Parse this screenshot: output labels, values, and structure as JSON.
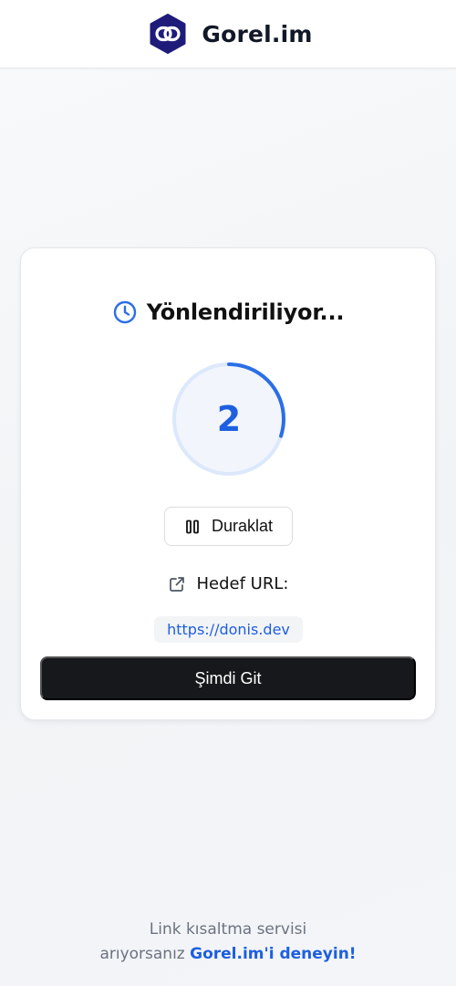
{
  "header": {
    "brand_name": "Gorel.im",
    "logo_icon": "link-chain-hexagon-icon",
    "logo_color": "#1e1b7a"
  },
  "card": {
    "title": "Yönlendiriliyor...",
    "title_icon": "clock-icon",
    "countdown": {
      "value": "2",
      "progress_fraction": 0.3
    },
    "pause_button": {
      "label": "Duraklat",
      "icon": "pause-icon"
    },
    "target": {
      "label": "Hedef URL:",
      "icon": "external-link-icon",
      "url": "https://donis.dev"
    },
    "go_button": {
      "label": "Şimdi Git"
    }
  },
  "footer": {
    "text_line1": "Link kısaltma servisi",
    "text_line2": "arıyorsanız",
    "link_label": "Gorel.im'i deneyin!"
  },
  "colors": {
    "accent": "#1d5fe0",
    "ring_track": "#dce8fb",
    "ring_progress": "#2b6fe6",
    "button_dark": "#17181b"
  }
}
